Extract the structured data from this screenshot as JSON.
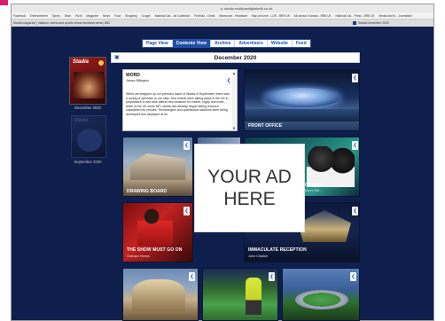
{
  "browser": {
    "url": "a. studia.multipasdigitaledit.co.uk",
    "bookmarks": [
      "Facebook",
      "Entertainment",
      "Sports",
      "Work",
      "Work",
      "Magazine",
      "News",
      "Food",
      "Shopping",
      "Google",
      "National Gal... art Collection",
      "Portfolio - Creati",
      "Newsroom - Headstart",
      "Map at home - LLRI - BRN UK",
      "All across t Kansas - BRN UK",
      "National Gal... Press - BRN UK",
      "Media and th... Journalism"
    ],
    "tab_left": "Stadia magazine | stadium, arena and sports venue business news | 882",
    "tab_right": "Stadia December 2020"
  },
  "nav": {
    "items": [
      "Page View",
      "Contents View",
      "Archive",
      "Advertisers",
      "Website",
      "Feed"
    ],
    "active_index": 1
  },
  "issue": {
    "title": "December 2020"
  },
  "sidebar": {
    "covers": [
      {
        "logo": "Stadia",
        "label": "December 2020"
      },
      {
        "logo": "Stadia",
        "label": "September 2020"
      }
    ]
  },
  "article": {
    "title": "WORD",
    "author": "James Billington",
    "body": "When we wrapped up our previous issue of Stadia in September, there was a spring of optimism in our step. Test events were taking place in the UK in preparation to see fans attend new seasons for cricket, rugby and more, while in the US some NFL stadia had already begun letting reduced capacities into venues. Technologies and operational solutions were being developed and deployed at an"
  },
  "tiles": [
    {
      "caption": "FRONT OFFICE",
      "author": ""
    },
    {
      "caption": "DRAWING BOARD",
      "author": ""
    },
    {
      "caption": "GREEN",
      "author": "Steve Wil..."
    },
    {
      "caption": "THE SHOW MUST GO ON",
      "author": "Graham Heeps"
    },
    {
      "caption": "IMMACULATE RECEPTION",
      "author": "John Challen"
    }
  ],
  "ad": {
    "text_line1": "YOUR AD",
    "text_line2": "HERE"
  },
  "icons": {
    "share": "share-icon",
    "book": "book-icon"
  },
  "colors": {
    "brand_blue": "#1d4fa8",
    "page_bg": "#0f1f4d",
    "accent_pink": "#d4206b"
  }
}
